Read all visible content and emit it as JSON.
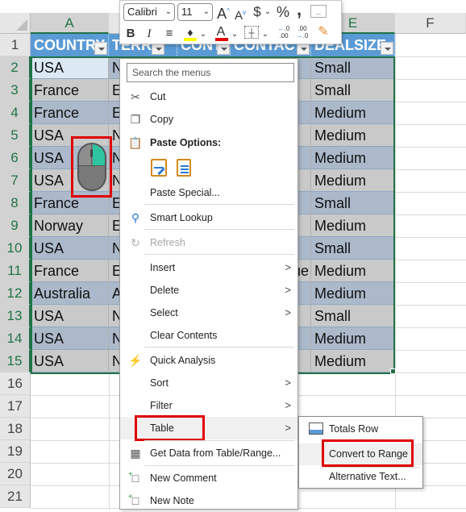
{
  "sheet": {
    "columns": [
      "A",
      "B",
      "C",
      "D",
      "E",
      "F"
    ],
    "selected_columns": [
      "A",
      "E"
    ],
    "row_numbers": [
      "1",
      "2",
      "3",
      "4",
      "5",
      "6",
      "7",
      "8",
      "9",
      "10",
      "11",
      "12",
      "13",
      "14",
      "15",
      "16",
      "17",
      "18",
      "19",
      "20",
      "21"
    ],
    "table_headers": [
      "COUNTRY",
      "TERRITORY",
      "CONTACT",
      "CONTACT",
      "DEALSIZE"
    ],
    "table_headers_visible": [
      "COUNTRY",
      "TERR",
      "CONTAC",
      "CONTAC",
      "DEALSIZE"
    ],
    "rows": [
      {
        "country": "USA",
        "territory": "N",
        "dealsize": "Small"
      },
      {
        "country": "France",
        "territory": "E",
        "dealsize": "Small"
      },
      {
        "country": "France",
        "territory": "E",
        "dealsize": "Medium"
      },
      {
        "country": "USA",
        "territory": "N",
        "dealsize": "Medium"
      },
      {
        "country": "USA",
        "territory": "N",
        "dealsize": "Medium"
      },
      {
        "country": "USA",
        "territory": "N",
        "dealsize": "Medium"
      },
      {
        "country": "France",
        "territory": "E",
        "dealsize": "Small"
      },
      {
        "country": "Norway",
        "territory": "E",
        "dealsize": "Medium"
      },
      {
        "country": "USA",
        "territory": "N",
        "dealsize": "Small"
      },
      {
        "country": "France",
        "territory": "E",
        "dealsize": "Medium",
        "contact_overflow": "ue"
      },
      {
        "country": "Australia",
        "territory": "A",
        "dealsize": "Medium"
      },
      {
        "country": "USA",
        "territory": "N",
        "dealsize": "Small"
      },
      {
        "country": "USA",
        "territory": "N",
        "dealsize": "Medium"
      },
      {
        "country": "USA",
        "territory": "N",
        "dealsize": "Medium"
      }
    ]
  },
  "mini_toolbar": {
    "font_name": "Calibri",
    "font_size": "11",
    "increase_font": "A",
    "decrease_font": "A",
    "currency": "$",
    "percent": "%",
    "comma": ",",
    "bold": "B",
    "italic": "I",
    "font_color_letter": "A",
    "fill_color": "#ffff00",
    "font_color": "#e00000"
  },
  "context_menu": {
    "search_placeholder": "Search the menus",
    "items": {
      "cut": "Cut",
      "copy": "Copy",
      "paste_options": "Paste Options:",
      "paste_special": "Paste Special...",
      "smart_lookup": "Smart Lookup",
      "refresh": "Refresh",
      "insert": "Insert",
      "delete": "Delete",
      "select": "Select",
      "clear_contents": "Clear Contents",
      "quick_analysis": "Quick Analysis",
      "sort": "Sort",
      "filter": "Filter",
      "table": "Table",
      "get_data": "Get Data from Table/Range...",
      "new_comment": "New Comment",
      "new_note": "New Note"
    }
  },
  "table_submenu": {
    "totals_row": "Totals Row",
    "convert_to_range": "Convert to Range",
    "alternative_text": "Alternative Text..."
  },
  "colors": {
    "table_header": "#5b9bd5",
    "band_dark": "#acb9ca",
    "band_light": "#c9c9c9",
    "selection": "#217346",
    "highlight_box": "#e00000"
  }
}
